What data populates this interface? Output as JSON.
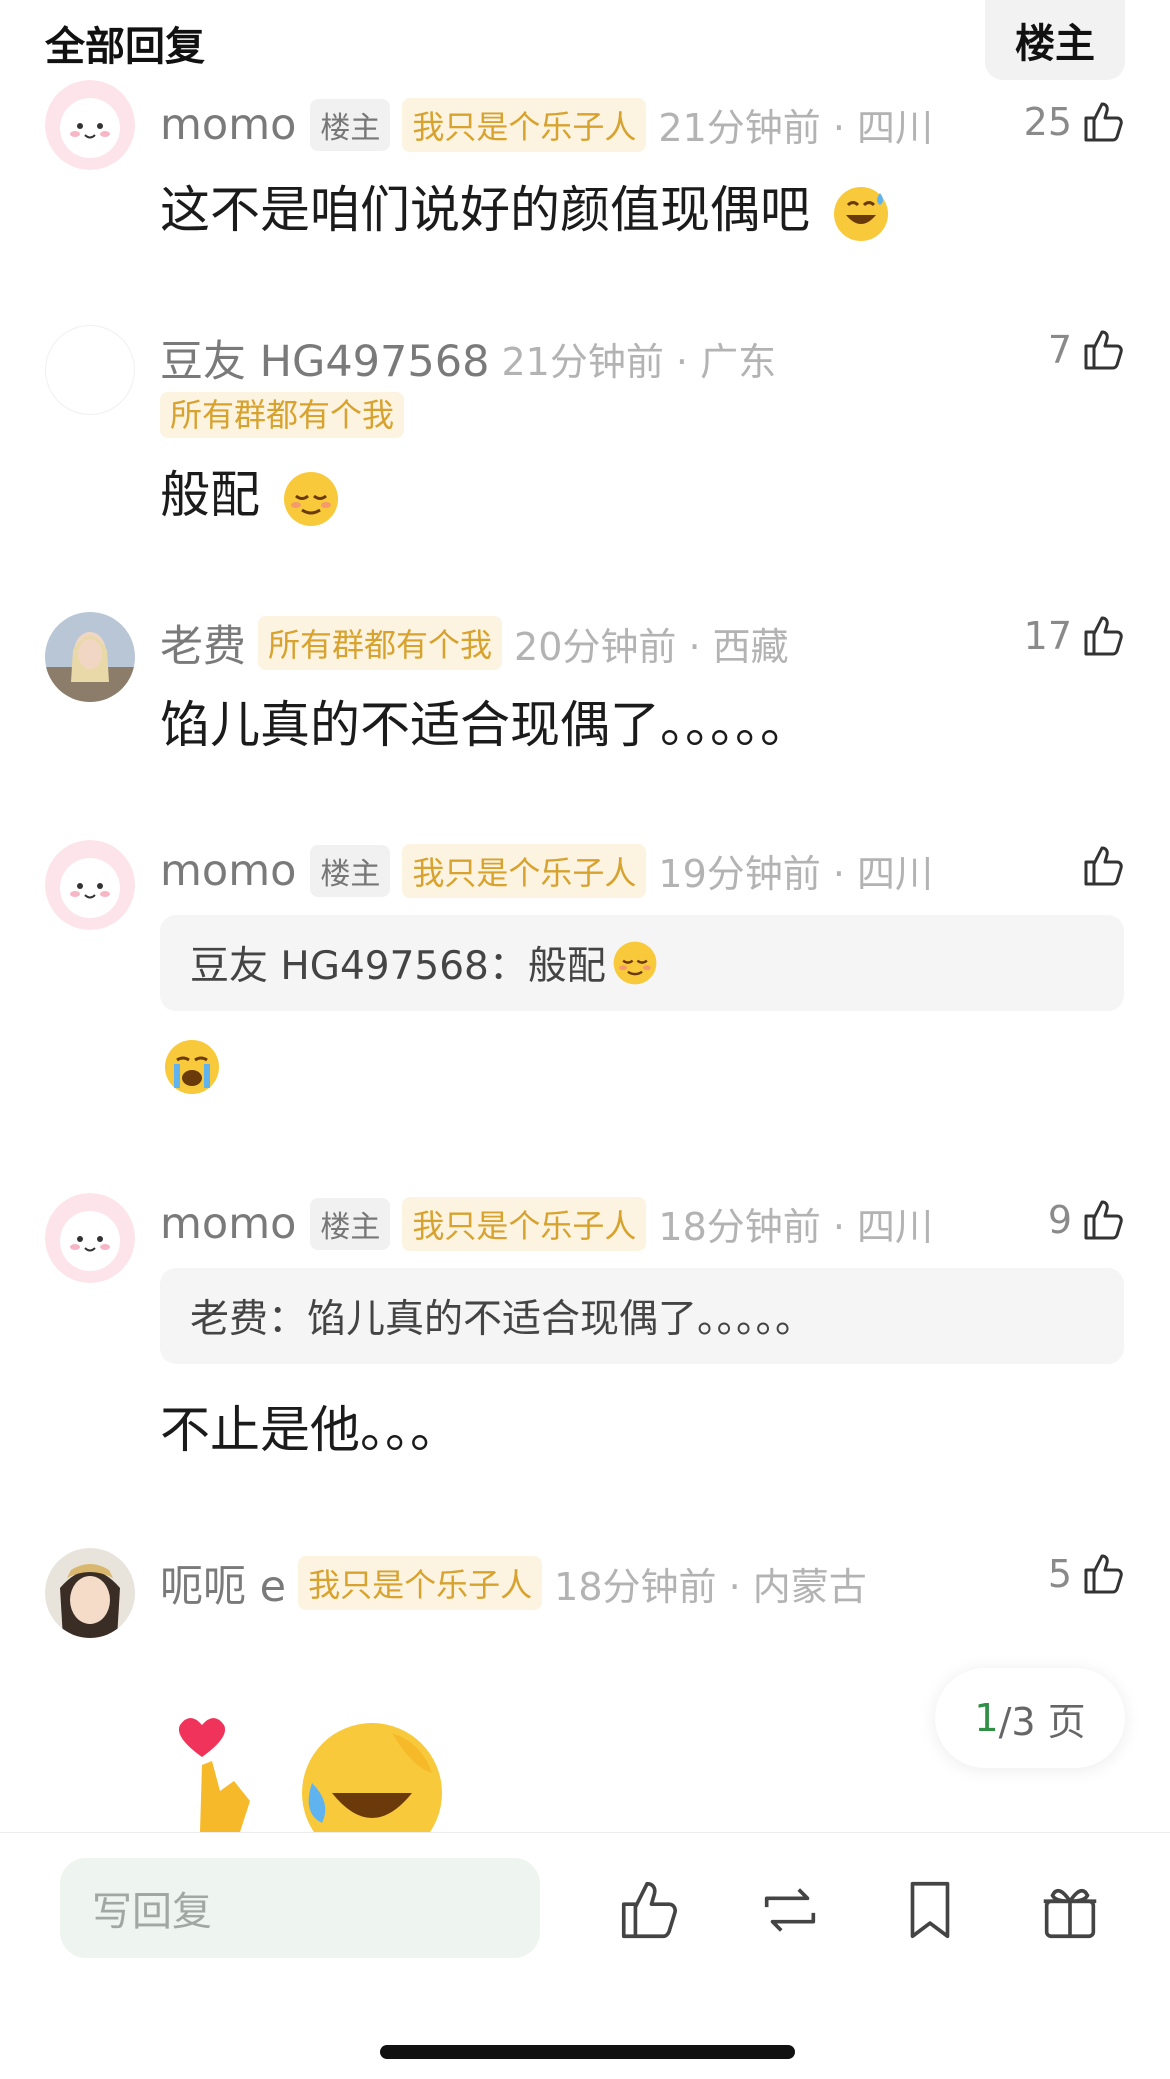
{
  "header": {
    "title": "全部回复",
    "filter_label": "楼主"
  },
  "comments": [
    {
      "username": "momo",
      "op_badge": "楼主",
      "tag": "我只是个乐子人",
      "time": "21分钟前 · 四川",
      "likes": "25",
      "text": "这不是咱们说好的颜值现偶吧"
    },
    {
      "username": "豆友 HG497568",
      "time": "21分钟前 · 广东",
      "tag": "所有群都有个我",
      "likes": "7",
      "text": "般配"
    },
    {
      "username": "老费",
      "tag": "所有群都有个我",
      "time": "20分钟前 · 西藏",
      "likes": "17",
      "text": "馅儿真的不适合现偶了。。。。。"
    },
    {
      "username": "momo",
      "op_badge": "楼主",
      "tag": "我只是个乐子人",
      "time": "19分钟前 · 四川",
      "quote": "豆友 HG497568：般配"
    },
    {
      "username": "momo",
      "op_badge": "楼主",
      "tag": "我只是个乐子人",
      "time": "18分钟前 · 四川",
      "likes": "9",
      "quote": "老费：馅儿真的不适合现偶了。。。。。",
      "text": "不止是他。。。"
    },
    {
      "username": "呃呃 e",
      "tag": "我只是个乐子人",
      "time": "18分钟前 · 内蒙古",
      "likes": "5"
    }
  ],
  "pager": {
    "current": "1",
    "total": "/3 页"
  },
  "bottom": {
    "reply_placeholder": "写回复"
  },
  "colors": {
    "tag_text": "#d7a22e",
    "tag_bg": "#fcf3e0",
    "accent_green": "#2f8f45"
  }
}
